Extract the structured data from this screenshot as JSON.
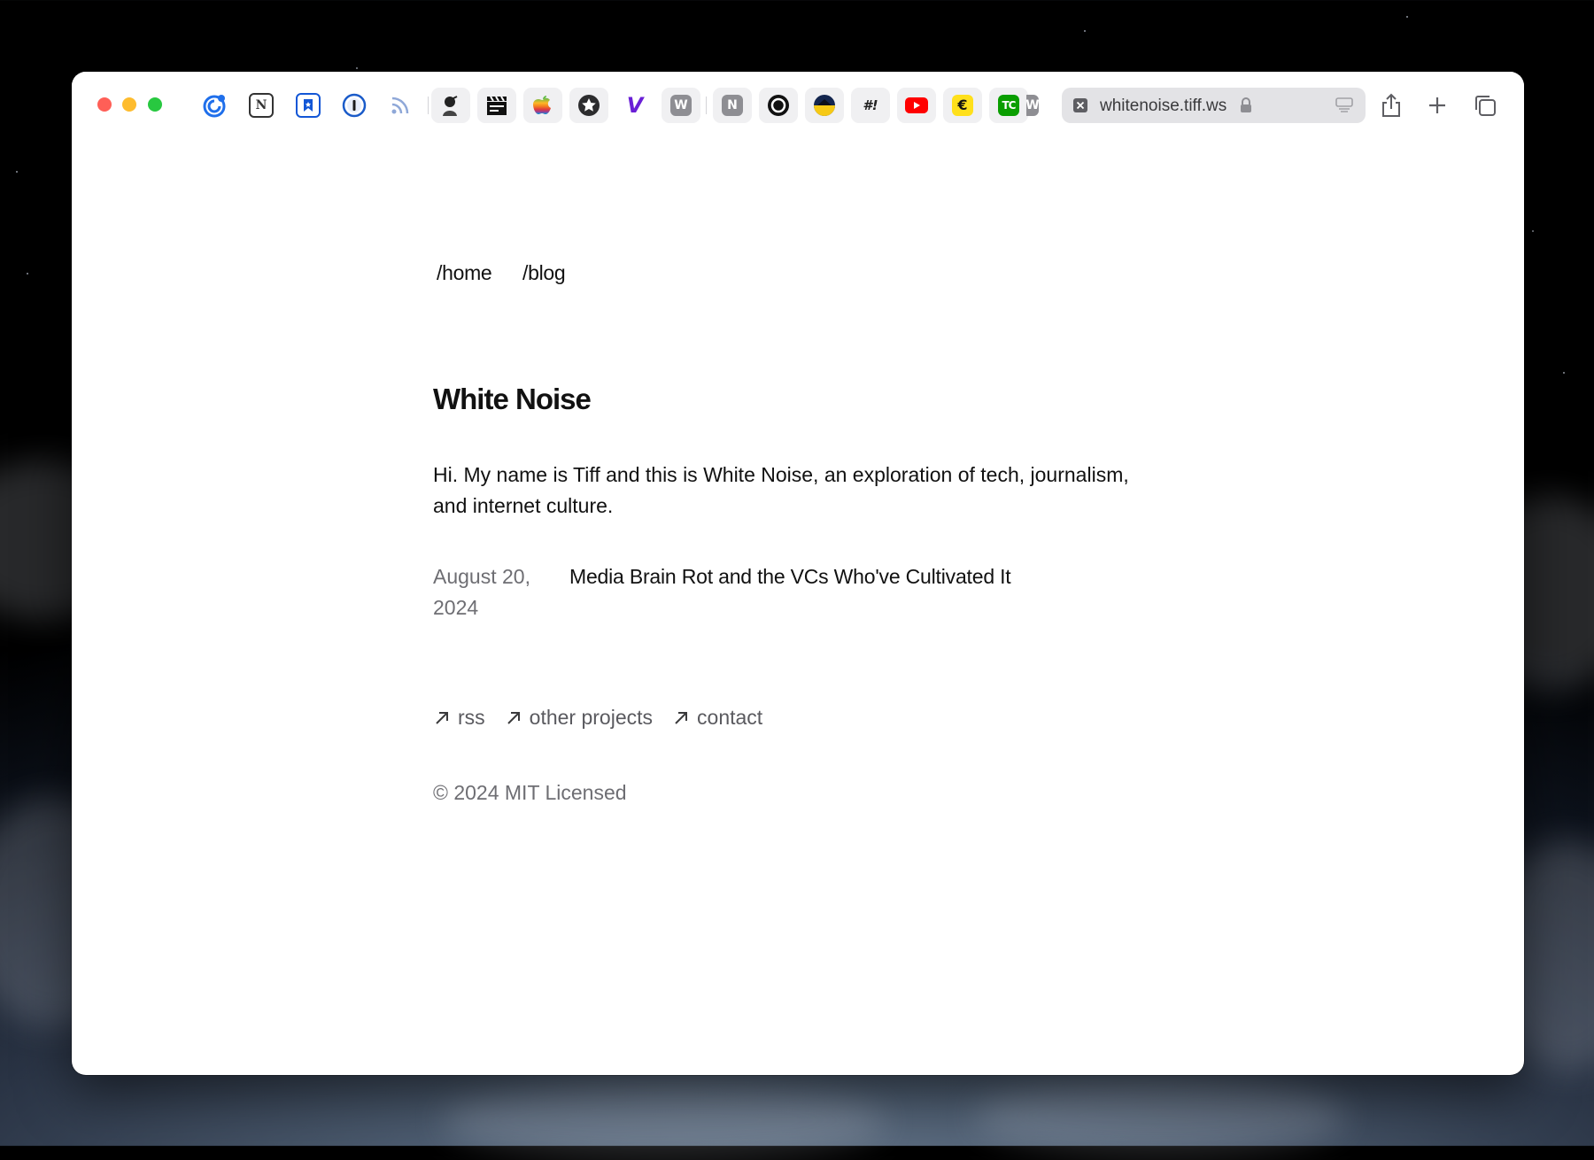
{
  "colors": {
    "traffic_close": "#ff5f57",
    "traffic_minimize": "#febc2e",
    "traffic_zoom": "#28c840",
    "body_text": "#111111",
    "muted_text": "#6e6e73",
    "url_bar_bg": "#e3e3e6"
  },
  "browser": {
    "traffic_lights": [
      "close",
      "minimize",
      "zoom"
    ],
    "favorites": [
      {
        "icon": "sync-circle-icon"
      },
      {
        "icon": "notion-icon",
        "glyph": "N"
      },
      {
        "icon": "bookmark-star-icon"
      },
      {
        "icon": "1password-icon"
      },
      {
        "icon": "rss-feed-icon"
      },
      {
        "icon": "portrait-icon"
      },
      {
        "icon": "clapperboard-icon"
      },
      {
        "icon": "apple-rainbow-icon"
      },
      {
        "icon": "star-circle-icon"
      },
      {
        "icon": "v-logo-icon",
        "glyph": "V"
      },
      {
        "icon": "w-square-icon",
        "glyph": "W"
      },
      {
        "icon": "n-square-icon",
        "glyph": "N"
      },
      {
        "icon": "ring-circle-icon"
      },
      {
        "icon": "split-circle-icon"
      },
      {
        "icon": "hashbang-icon",
        "glyph": "#!"
      },
      {
        "icon": "youtube-play-icon"
      },
      {
        "icon": "mailchimp-icon",
        "glyph": "€"
      },
      {
        "icon": "techcrunch-icon",
        "glyph": "TC"
      },
      {
        "icon": "w-partial-icon",
        "glyph": "W"
      }
    ],
    "url": "whitenoise.tiff.ws",
    "tab_icon": "close-square-icon",
    "lock_icon": "lock-icon",
    "reader_icon": "reader-mode-icon",
    "share_icon": "share-icon",
    "new_tab_icon": "plus-icon",
    "tabs_overview_icon": "tab-overview-icon"
  },
  "page": {
    "nav": {
      "home": "/home",
      "blog": "/blog"
    },
    "title": "White Noise",
    "intro": "Hi. My name is Tiff and this is White Noise, an exploration of tech, journalism, and internet culture.",
    "posts": [
      {
        "date": "August 20, 2024",
        "title": "Media Brain Rot and the VCs Who've Cultivated It"
      }
    ],
    "footer": {
      "links": [
        {
          "label": "rss",
          "icon": "arrow-up-right-icon"
        },
        {
          "label": "other projects",
          "icon": "arrow-up-right-icon"
        },
        {
          "label": "contact",
          "icon": "arrow-up-right-icon"
        }
      ],
      "copyright": "© 2024 MIT Licensed"
    }
  }
}
